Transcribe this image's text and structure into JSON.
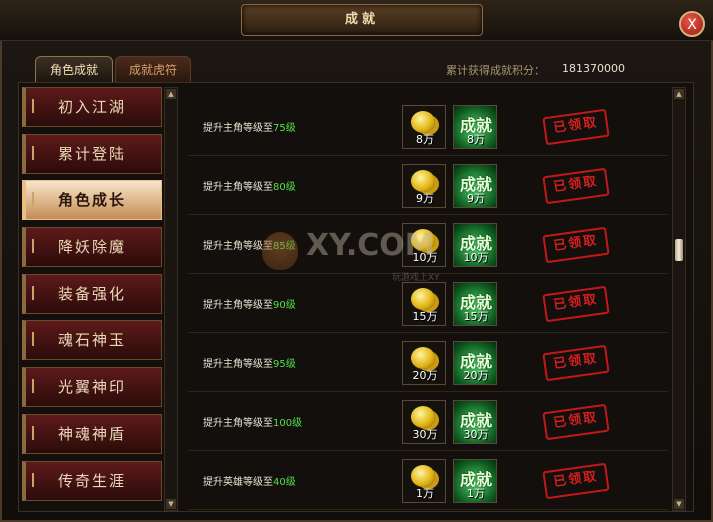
{
  "window": {
    "title": "成就",
    "close_label": "X"
  },
  "tabs": [
    {
      "label": "角色成就",
      "active": true
    },
    {
      "label": "成就虎符",
      "active": false
    }
  ],
  "score": {
    "label": "累计获得成就积分：",
    "value": "181370000"
  },
  "sidebar": {
    "items": [
      {
        "label": "初入江湖",
        "active": false
      },
      {
        "label": "累计登陆",
        "active": false
      },
      {
        "label": "角色成长",
        "active": true
      },
      {
        "label": "降妖除魔",
        "active": false
      },
      {
        "label": "装备强化",
        "active": false
      },
      {
        "label": "魂石神玉",
        "active": false
      },
      {
        "label": "光翼神印",
        "active": false
      },
      {
        "label": "神魂神盾",
        "active": false
      },
      {
        "label": "传奇生涯",
        "active": false
      }
    ]
  },
  "achievements": [
    {
      "text": "提升主角等级至",
      "level": "75级",
      "coin": "8万",
      "points": "8万",
      "status": "已领取",
      "achievement_label": "成就"
    },
    {
      "text": "提升主角等级至",
      "level": "80级",
      "coin": "9万",
      "points": "9万",
      "status": "已领取",
      "achievement_label": "成就"
    },
    {
      "text": "提升主角等级至",
      "level": "85级",
      "coin": "10万",
      "points": "10万",
      "status": "已领取",
      "achievement_label": "成就"
    },
    {
      "text": "提升主角等级至",
      "level": "90级",
      "coin": "15万",
      "points": "15万",
      "status": "已领取",
      "achievement_label": "成就"
    },
    {
      "text": "提升主角等级至",
      "level": "95级",
      "coin": "20万",
      "points": "20万",
      "status": "已领取",
      "achievement_label": "成就"
    },
    {
      "text": "提升主角等级至",
      "level": "100级",
      "coin": "30万",
      "points": "30万",
      "status": "已领取",
      "achievement_label": "成就"
    },
    {
      "text": "提升英雄等级至",
      "level": "40级",
      "coin": "1万",
      "points": "1万",
      "status": "已领取",
      "achievement_label": "成就"
    }
  ],
  "watermark": {
    "text": "XY.COM",
    "sub": "玩游戏上XY"
  },
  "scroll": {
    "position": 0.4
  }
}
